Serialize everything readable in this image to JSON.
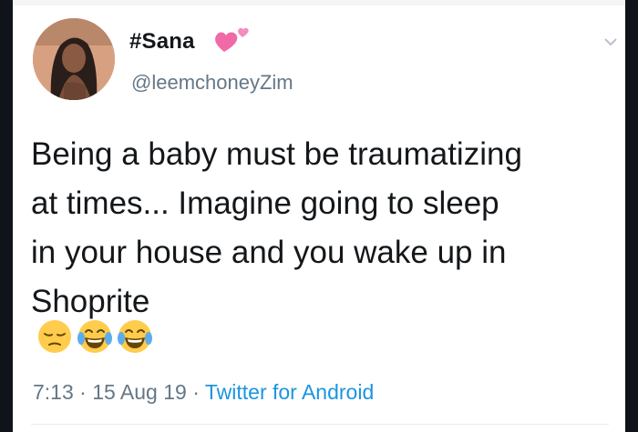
{
  "tweet": {
    "display_name": "#Sana",
    "handle": "@leemchoneyZim",
    "text_lines": [
      "Being a baby must be traumatizing",
      "at times... Imagine going to sleep",
      "in your house and you wake up in",
      "Shoprite"
    ],
    "emojis": [
      "pensive-face-icon",
      "tears-of-joy-icon",
      "tears-of-joy-icon"
    ],
    "time": "7:13",
    "date": "15 Aug 19",
    "source": "Twitter for Android",
    "separator": "·"
  },
  "icons": {
    "name_badge": "two-hearts-icon",
    "menu": "chevron-down-icon"
  },
  "colors": {
    "primary_text": "#14171a",
    "secondary_text": "#657786",
    "link": "#1b95e0",
    "heart": "#f06aa8"
  }
}
